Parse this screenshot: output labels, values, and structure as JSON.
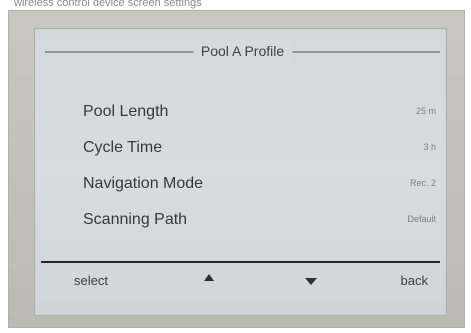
{
  "top_caption": {
    "text": "wireless control device screen settings"
  },
  "screen": {
    "title": "Pool A Profile",
    "items": [
      {
        "label": "Pool Length",
        "value": "25 m"
      },
      {
        "label": "Cycle Time",
        "value": "3 h"
      },
      {
        "label": "Navigation Mode",
        "value": "Rec. 2"
      },
      {
        "label": "Scanning Path",
        "value": "Default"
      }
    ],
    "softkeys": {
      "select": "select",
      "up_icon": "up-arrow-icon",
      "down_icon": "down-arrow-icon",
      "back": "back"
    }
  },
  "colors": {
    "frame": "#c2c2ba",
    "screen": "#d5dbdd",
    "text": "#353940",
    "rule": "#8f9599",
    "divider": "#25282d"
  }
}
